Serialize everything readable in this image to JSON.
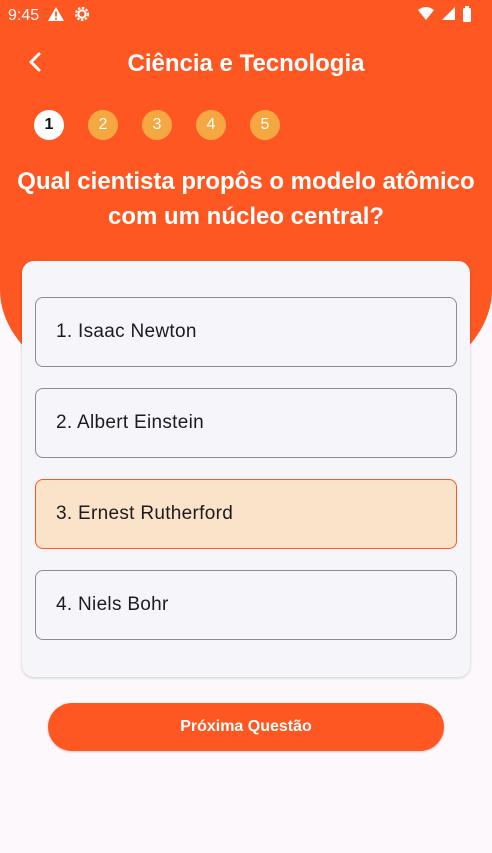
{
  "status_bar": {
    "time": "9:45",
    "icons_left": [
      "alert-icon",
      "settings-icon"
    ],
    "icons_right": [
      "wifi-icon",
      "signal-icon",
      "battery-icon"
    ]
  },
  "app_bar": {
    "back_icon": "chevron-left-icon",
    "title": "Ciência e Tecnologia"
  },
  "steps": [
    {
      "label": "1",
      "state": "active"
    },
    {
      "label": "2",
      "state": "inactive"
    },
    {
      "label": "3",
      "state": "inactive"
    },
    {
      "label": "4",
      "state": "inactive"
    },
    {
      "label": "5",
      "state": "inactive"
    }
  ],
  "question": {
    "text": "Qual cientista propôs o modelo atômico com um núcleo central?"
  },
  "options": [
    {
      "label": "1. Isaac Newton",
      "selected": false
    },
    {
      "label": "2. Albert Einstein",
      "selected": false
    },
    {
      "label": "3. Ernest Rutherford",
      "selected": true
    },
    {
      "label": "4. Niels Bohr",
      "selected": false
    }
  ],
  "next_button": {
    "label": "Próxima Questão"
  },
  "colors": {
    "primary": "#ff5722",
    "step_inactive": "#f5a742",
    "selected_bg": "#fae3c9",
    "card_bg": "#f6f5fa"
  }
}
